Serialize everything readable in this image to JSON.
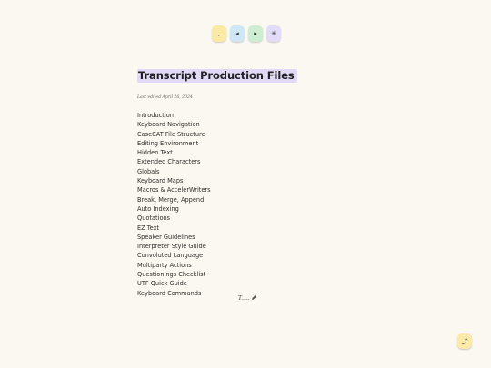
{
  "toolbar": {
    "buttons": [
      {
        "icon": "comma-icon",
        "glyph": ",",
        "color": "#fbe9a6"
      },
      {
        "icon": "prev-arrow-icon",
        "glyph": "◂",
        "color": "#cfe6f7"
      },
      {
        "icon": "next-arrow-icon",
        "glyph": "▸",
        "color": "#cdeed2"
      },
      {
        "icon": "sparkle-icon",
        "glyph": "✳",
        "color": "#e3dcf8"
      }
    ]
  },
  "document": {
    "title": "Transcript Production Files",
    "last_edited": "Last edited April 26, 2024",
    "toc": [
      "Introduction",
      "Keyboard Navigation",
      "CaseCAT File Structure",
      "Editing Environment",
      "Hidden Text",
      "Extended Characters",
      "Globals",
      "Keyboard Maps",
      "Macros & AccelerWriters",
      "Break, Merge, Append",
      "Auto Indexing",
      "Quotations",
      "EZ Text",
      "Speaker Guidelines",
      "Interpreter Style Guide",
      "Convoluted Language",
      "Multiparty Actions",
      "Questionings Checklist",
      "UTF Quick Guide",
      "Keyboard Commands"
    ],
    "signature": "T.....",
    "signature_icon": "pen-icon"
  },
  "scroll_top": {
    "icon": "scroll-top-icon",
    "glyph": "⤴",
    "color": "#fbeaa8"
  }
}
